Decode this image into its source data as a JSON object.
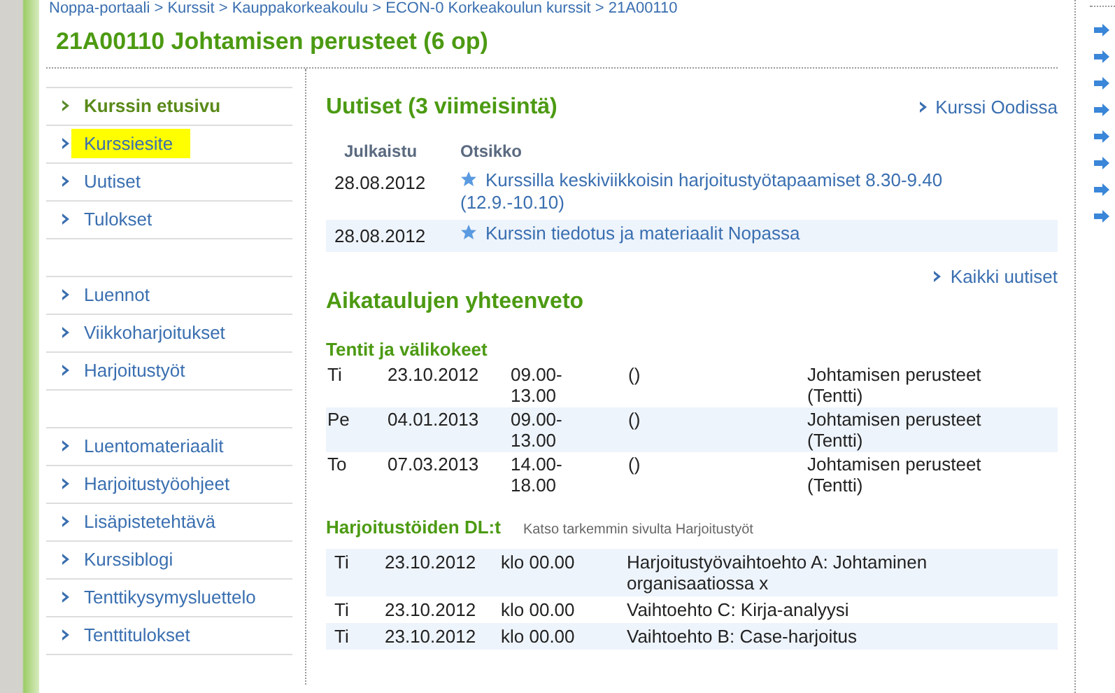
{
  "breadcrumb": "Noppa-portaali > Kurssit > Kauppakorkeakoulu > ECON-0 Korkeakoulun kurssit > 21A00110",
  "title": "21A00110 Johtamisen perusteet (6 op)",
  "sidebar": {
    "groups": [
      {
        "items": [
          {
            "label": "Kurssin etusivu",
            "selected": true,
            "highlighted": false
          },
          {
            "label": "Kurssiesite",
            "selected": false,
            "highlighted": true
          },
          {
            "label": "Uutiset",
            "selected": false,
            "highlighted": false
          },
          {
            "label": "Tulokset",
            "selected": false,
            "highlighted": false
          }
        ]
      },
      {
        "items": [
          {
            "label": "Luennot",
            "selected": false,
            "highlighted": false
          },
          {
            "label": "Viikkoharjoitukset",
            "selected": false,
            "highlighted": false
          },
          {
            "label": "Harjoitustyöt",
            "selected": false,
            "highlighted": false
          }
        ]
      },
      {
        "items": [
          {
            "label": "Luentomateriaalit",
            "selected": false,
            "highlighted": false
          },
          {
            "label": "Harjoitustyöohjeet",
            "selected": false,
            "highlighted": false
          },
          {
            "label": "Lisäpistetehtävä",
            "selected": false,
            "highlighted": false
          },
          {
            "label": "Kurssiblogi",
            "selected": false,
            "highlighted": false
          },
          {
            "label": "Tenttikysymysluettelo",
            "selected": false,
            "highlighted": false
          },
          {
            "label": "Tenttitulokset",
            "selected": false,
            "highlighted": false
          }
        ]
      }
    ]
  },
  "news": {
    "heading": "Uutiset (3 viimeisintä)",
    "link": "Kurssi Oodissa",
    "columns": [
      "Julkaistu",
      "Otsikko"
    ],
    "rows": [
      {
        "date": "28.08.2012",
        "title": "Kurssilla keskiviikkoisin harjoitustyötapaamiset 8.30-9.40 (12.9.-10.10)"
      },
      {
        "date": "28.08.2012",
        "title": "Kurssin tiedotus ja materiaalit Nopassa"
      }
    ],
    "all_link": "Kaikki uutiset"
  },
  "schedule": {
    "heading": "Aikataulujen yhteenveto",
    "exams": {
      "heading": "Tentit ja välikokeet",
      "rows": [
        {
          "day": "Ti",
          "date": "23.10.2012",
          "time": "09.00-13.00",
          "place": "()",
          "name": "Johtamisen perusteet (Tentti)"
        },
        {
          "day": "Pe",
          "date": "04.01.2013",
          "time": "09.00-13.00",
          "place": "()",
          "name": "Johtamisen perusteet (Tentti)"
        },
        {
          "day": "To",
          "date": "07.03.2013",
          "time": "14.00-18.00",
          "place": "()",
          "name": "Johtamisen perusteet (Tentti)"
        }
      ]
    },
    "deadlines": {
      "heading": "Harjoitustöiden DL:t",
      "note": "Katso tarkemmin sivulta Harjoitustyöt",
      "rows": [
        {
          "day": "Ti",
          "date": "23.10.2012",
          "time": "klo 00.00",
          "name": "Harjoitustyövaihtoehto A: Johtaminen organisaatiossa x"
        },
        {
          "day": "Ti",
          "date": "23.10.2012",
          "time": "klo 00.00",
          "name": "Vaihtoehto C: Kirja-analyysi"
        },
        {
          "day": "Ti",
          "date": "23.10.2012",
          "time": "klo 00.00",
          "name": "Vaihtoehto B: Case-harjoitus"
        }
      ]
    }
  }
}
